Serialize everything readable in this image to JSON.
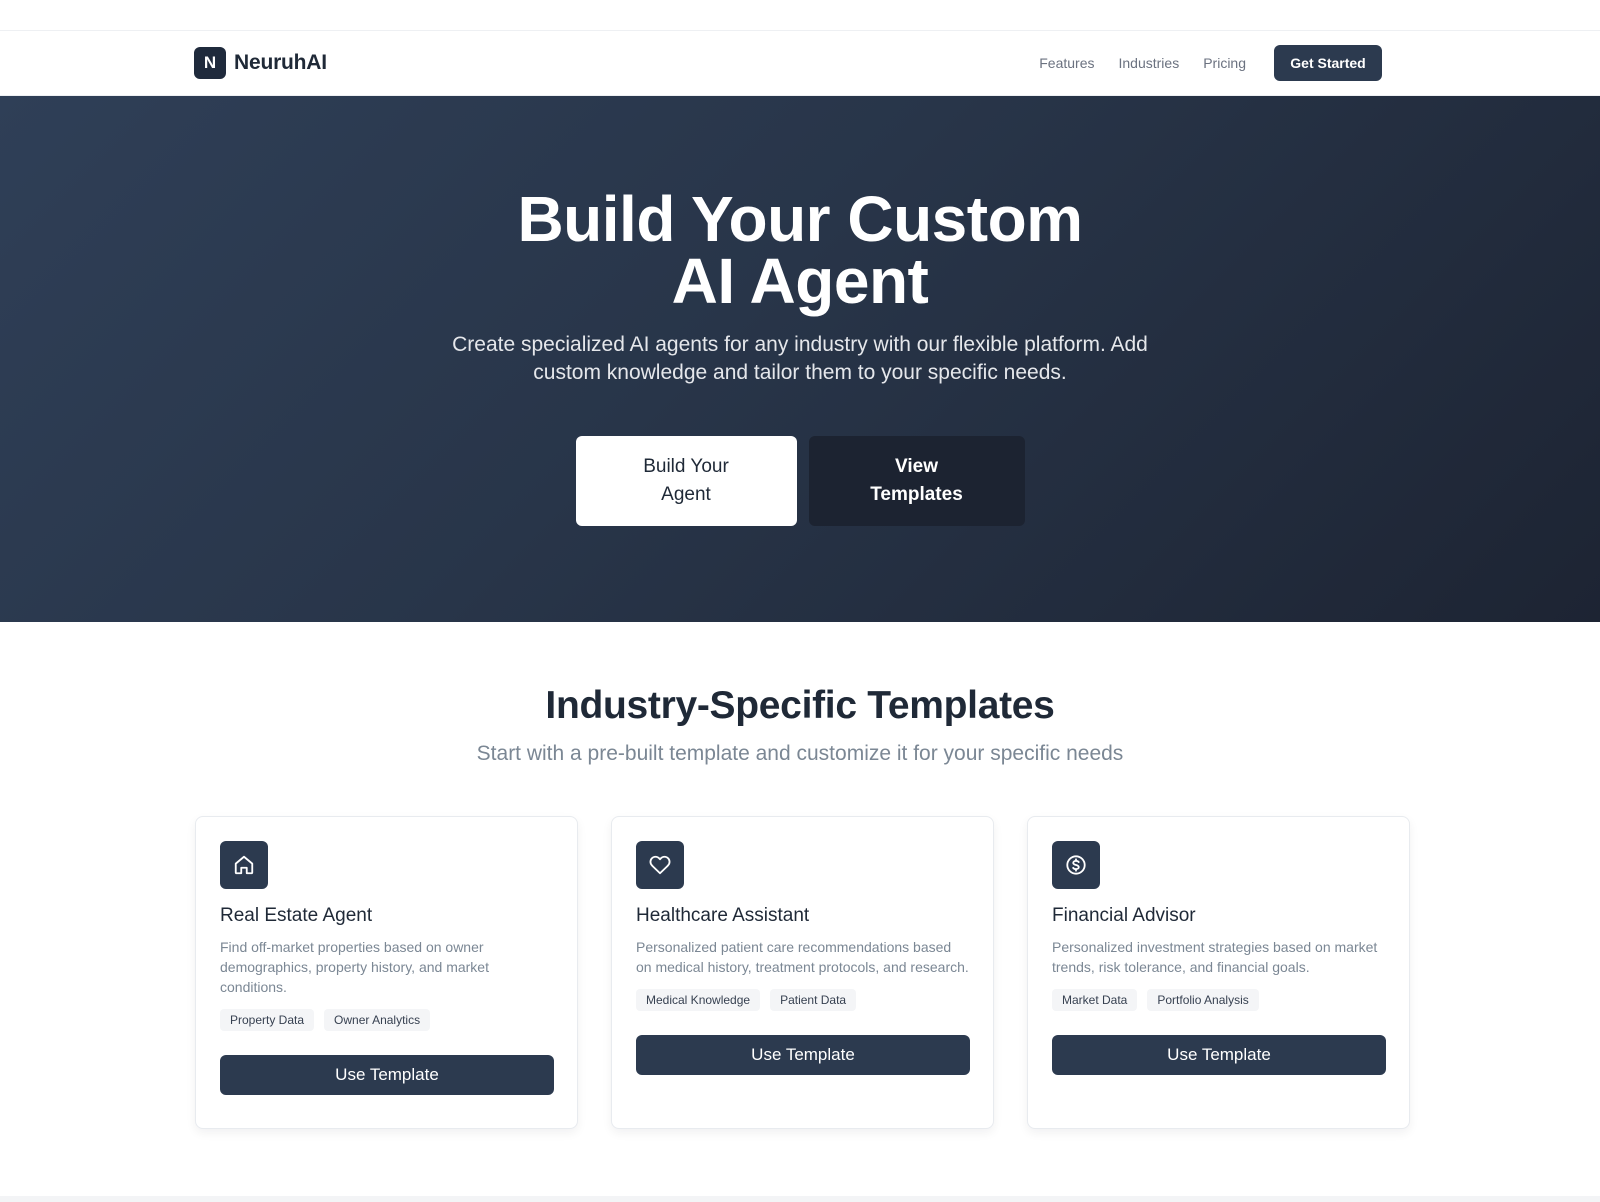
{
  "nav": {
    "logo_letter": "N",
    "brand": "NeuruhAI",
    "links": [
      "Features",
      "Industries",
      "Pricing"
    ],
    "cta": "Get Started"
  },
  "hero": {
    "title_line1": "Build Your Custom",
    "title_line2": "AI Agent",
    "subtitle": "Create specialized AI agents for any industry with our flexible platform. Add custom knowledge and tailor them to your specific needs.",
    "primary_button": "Build Your Agent",
    "secondary_button": "View Templates"
  },
  "templates": {
    "title": "Industry-Specific Templates",
    "subtitle": "Start with a pre-built template and customize it for your specific needs",
    "cards": [
      {
        "icon": "home-icon",
        "title": "Real Estate Agent",
        "description": "Find off-market properties based on owner demographics, property history, and market conditions.",
        "tags": [
          "Property Data",
          "Owner Analytics"
        ],
        "button": "Use Template"
      },
      {
        "icon": "heart-icon",
        "title": "Healthcare Assistant",
        "description": "Personalized patient care recommendations based on medical history, treatment protocols, and research.",
        "tags": [
          "Medical Knowledge",
          "Patient Data"
        ],
        "button": "Use Template"
      },
      {
        "icon": "dollar-circle-icon",
        "title": "Financial Advisor",
        "description": "Personalized investment strategies based on market trends, risk tolerance, and financial goals.",
        "tags": [
          "Market Data",
          "Portfolio Analysis"
        ],
        "button": "Use Template"
      }
    ]
  },
  "colors": {
    "brand_dark": "#2c3a4f",
    "hero_start": "#2f3f57",
    "hero_end": "#1d2433",
    "muted_text": "#7b8794"
  }
}
